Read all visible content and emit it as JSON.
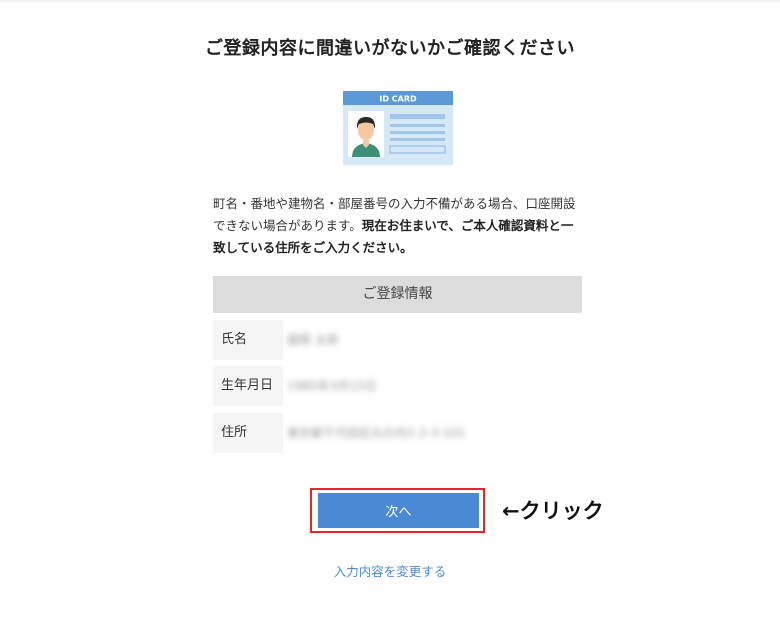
{
  "page": {
    "title": "ご登録内容に間違いがないかご確認ください",
    "id_card_label": "ID CARD",
    "notice_normal": "町名・番地や建物名・部屋番号の入力不備がある場合、口座開設できない場合があります。",
    "notice_bold": "現在お住まいで、ご本人確認資料と一致している住所をご入力ください。"
  },
  "info": {
    "header": "ご登録情報",
    "rows": [
      {
        "label": "氏名",
        "value": "國際 太郎"
      },
      {
        "label": "生年月日",
        "value": "1985年3月15日"
      },
      {
        "label": "住所",
        "value": "東京都千代田区丸の内1-2-3-101"
      }
    ]
  },
  "actions": {
    "next_label": "次へ",
    "annotation": "←クリック",
    "change_link": "入力内容を変更する"
  },
  "colors": {
    "accent": "#4a8ad4",
    "highlight_border": "#e02828",
    "header_bg": "#dcdcdc",
    "card_blue": "#5b9ad6"
  }
}
